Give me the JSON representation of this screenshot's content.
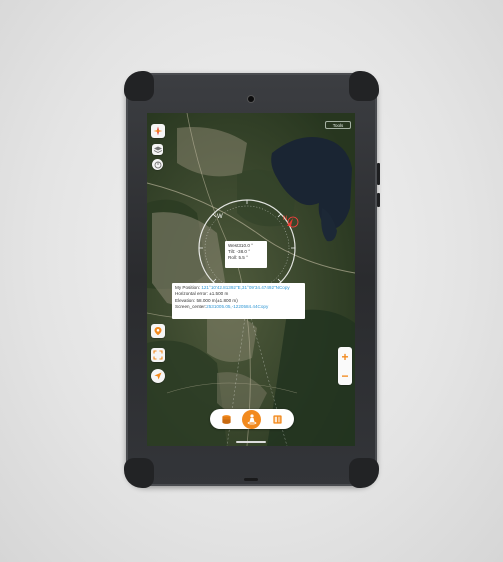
{
  "status_bar": {
    "time": "",
    "indicators": ""
  },
  "top_right_button": {
    "label": "Tools"
  },
  "left_tools": [
    {
      "icon": "compass-rose-icon"
    },
    {
      "icon": "layers-icon"
    },
    {
      "icon": "measure-icon"
    }
  ],
  "orientation": {
    "heading": "West310.0 °",
    "tilt": "Tilt: -38.0 °",
    "roll": "Roll: 5.5 °"
  },
  "position_info": {
    "my_position_label": "My Position:",
    "my_position_value": "121°10'42.81392\"E,31°09'34.47492\"N",
    "copy1": "Copy",
    "horizontal_error": "Horizontal error:   ±1.500 m",
    "elevation": "Elevation:   58.000 m(±1.800 m)",
    "screen_center_label": "Screen_center:",
    "screen_center_value": "2531005.05,-1220584.44",
    "copy2": "Copy"
  },
  "zoom": {
    "plus": "+",
    "minus": "−"
  },
  "bottom_bar": {
    "left_icon": "database-icon",
    "center_icon": "location-person-icon",
    "right_icon": "map-book-icon"
  },
  "colors": {
    "accent": "#f28a1e",
    "link": "#2f97d4",
    "tablet": "#2f3033"
  }
}
